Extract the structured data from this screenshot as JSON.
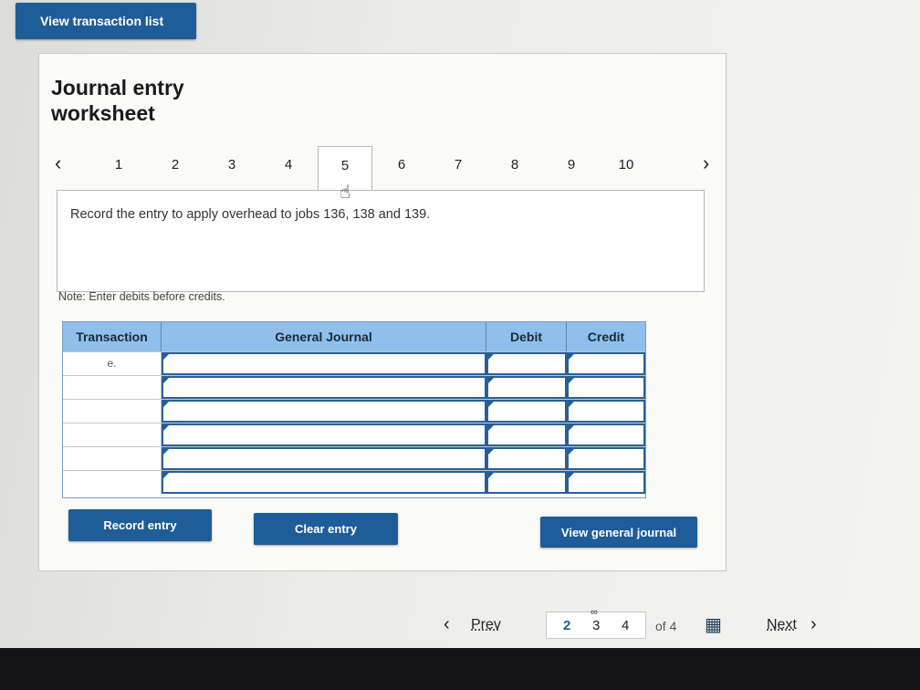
{
  "top": {
    "view_transaction_list": "View transaction list"
  },
  "worksheet": {
    "title": "Journal entry worksheet",
    "tabs": [
      "1",
      "2",
      "3",
      "4",
      "5",
      "6",
      "7",
      "8",
      "9",
      "10"
    ],
    "active_tab": "5",
    "prev_tab_icon": "chevron-left-icon",
    "next_tab_icon": "chevron-right-icon",
    "instruction": "Record the entry to apply overhead to jobs 136, 138 and 139.",
    "note": "Note: Enter debits before credits."
  },
  "journal": {
    "headers": {
      "transaction": "Transaction",
      "general_journal": "General Journal",
      "debit": "Debit",
      "credit": "Credit"
    },
    "rows": [
      {
        "transaction": "e.",
        "account": "",
        "debit": "",
        "credit": ""
      },
      {
        "transaction": "",
        "account": "",
        "debit": "",
        "credit": ""
      },
      {
        "transaction": "",
        "account": "",
        "debit": "",
        "credit": ""
      },
      {
        "transaction": "",
        "account": "",
        "debit": "",
        "credit": ""
      },
      {
        "transaction": "",
        "account": "",
        "debit": "",
        "credit": ""
      },
      {
        "transaction": "",
        "account": "",
        "debit": "",
        "credit": ""
      }
    ]
  },
  "buttons": {
    "record_entry": "Record entry",
    "clear_entry": "Clear entry",
    "view_general_journal": "View general journal"
  },
  "pager": {
    "prev": "Prev",
    "next": "Next",
    "pages": [
      "2",
      "3",
      "4"
    ],
    "current": "3",
    "of_label": "of 4",
    "grid_icon": "grid-icon",
    "link_icon": "link-icon"
  },
  "colors": {
    "accent": "#1f5d99",
    "header_blue": "#8fbfea"
  }
}
